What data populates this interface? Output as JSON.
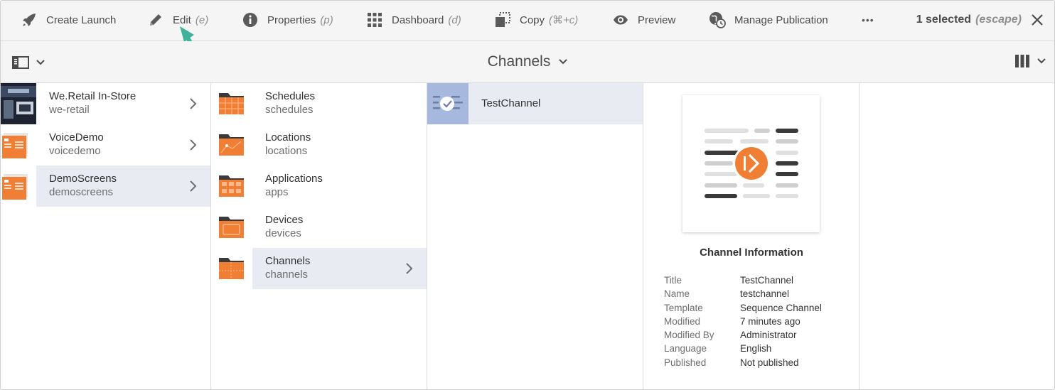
{
  "actionbar": {
    "create_launch": "Create Launch",
    "edit": "Edit",
    "edit_key": "(e)",
    "properties": "Properties",
    "properties_key": "(p)",
    "dashboard": "Dashboard",
    "dashboard_key": "(d)",
    "copy": "Copy",
    "copy_key": "(⌘+c)",
    "preview": "Preview",
    "manage_publication": "Manage Publication",
    "more": "•••",
    "selected_count": "1 selected",
    "escape_hint": "(escape)",
    "close": "✕"
  },
  "titlebar": {
    "title": "Channels"
  },
  "column1": {
    "items": [
      {
        "title": "We.Retail In-Store",
        "sub": "we-retail"
      },
      {
        "title": "VoiceDemo",
        "sub": "voicedemo"
      },
      {
        "title": "DemoScreens",
        "sub": "demoscreens"
      }
    ]
  },
  "column2": {
    "items": [
      {
        "title": "Schedules",
        "sub": "schedules"
      },
      {
        "title": "Locations",
        "sub": "locations"
      },
      {
        "title": "Applications",
        "sub": "apps"
      },
      {
        "title": "Devices",
        "sub": "devices"
      },
      {
        "title": "Channels",
        "sub": "channels"
      }
    ]
  },
  "column3": {
    "items": [
      {
        "title": "TestChannel"
      }
    ]
  },
  "info": {
    "heading": "Channel Information",
    "rows": [
      {
        "k": "Title",
        "v": "TestChannel"
      },
      {
        "k": "Name",
        "v": "testchannel"
      },
      {
        "k": "Template",
        "v": "Sequence Channel"
      },
      {
        "k": "Modified",
        "v": "7 minutes ago"
      },
      {
        "k": "Modified By",
        "v": "Administrator"
      },
      {
        "k": "Language",
        "v": "English"
      },
      {
        "k": "Published",
        "v": "Not published"
      }
    ]
  },
  "colors": {
    "accent_orange": "#f07f35",
    "selection": "#e8ebf1",
    "arrow_teal": "#3fb39a"
  }
}
